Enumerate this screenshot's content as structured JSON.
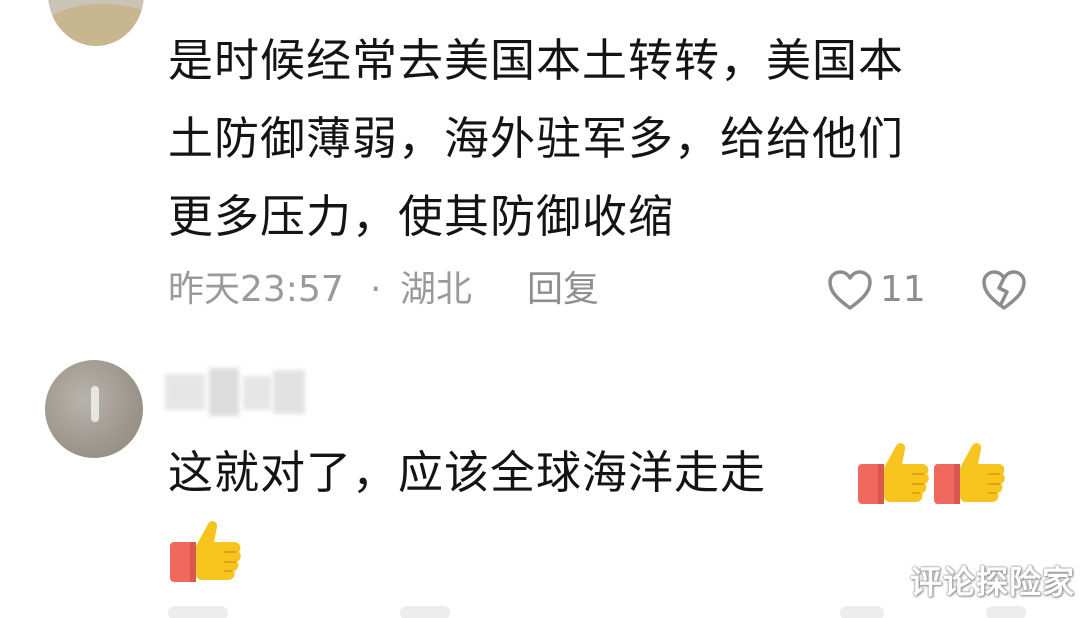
{
  "comments": [
    {
      "lines": [
        "是时候经常去美国本土转转，美国本",
        "土防御薄弱，海外驻军多，给给他们",
        "更多压力，使其防御收缩"
      ],
      "time": "昨天23:57",
      "separator": "·",
      "location": "湖北",
      "reply_label": "回复",
      "like_count": "11",
      "like_icon": "heart-outline-icon",
      "dislike_icon": "broken-heart-icon"
    },
    {
      "username_blurred": true,
      "lines": [
        "这就对了，应该全球海洋走走"
      ],
      "emoji": [
        "thumbs-up",
        "thumbs-up",
        "thumbs-up"
      ]
    }
  ],
  "watermark": "评论探险家",
  "colors": {
    "text_primary": "#141414",
    "text_meta": "#9a9a9a",
    "emoji_yellow": "#f7c31d",
    "emoji_sleeve": "#f0685e"
  }
}
